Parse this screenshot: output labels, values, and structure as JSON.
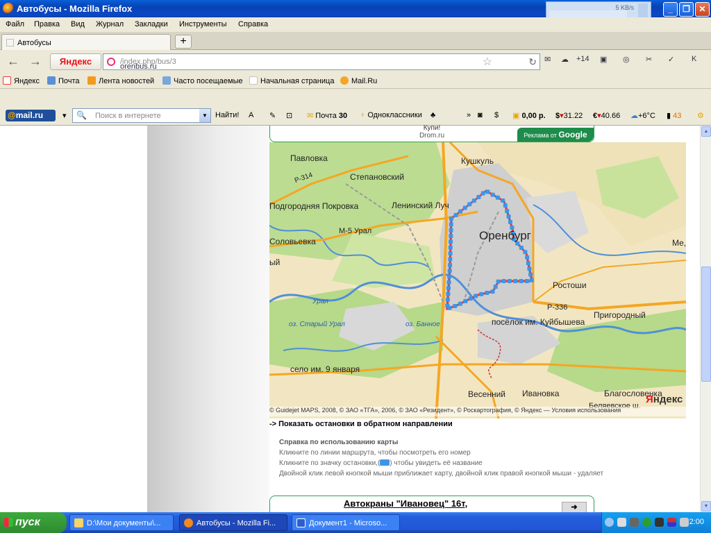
{
  "window": {
    "title": "Автобусы - Mozilla Firefox",
    "minimize": "_",
    "maximize": "❐",
    "close": "✕"
  },
  "netmeter": {
    "speed": "5 KB/s"
  },
  "menu": [
    "Файл",
    "Правка",
    "Вид",
    "Журнал",
    "Закладки",
    "Инструменты",
    "Справка"
  ],
  "tab": {
    "label": "Автобусы",
    "newtab": "+"
  },
  "nav": {
    "back": "←",
    "forward": "→",
    "yandex_button": "Яндекс",
    "url_host": "orenbus.ru",
    "url_path": "/index.php/bus/3",
    "weather_delta": "+14"
  },
  "bookmarks": [
    "Яндекс",
    "Почта",
    "Лента новостей",
    "Часто посещаемые",
    "Начальная страница",
    "Mail.Ru"
  ],
  "mailbar": {
    "logo_at": "@",
    "logo_text": "mail.ru",
    "search_placeholder": "Поиск в интернете",
    "find_button": "Найти!",
    "mail_label": "Почта",
    "mail_count": "30",
    "odnoklassniki": "Одноклассники",
    "balance": "0,00 р.",
    "usd": "31.22",
    "eur": "40.66",
    "temp": "+6°C",
    "count": "43"
  },
  "ad_top": {
    "line1": "Купи!",
    "line2": "Drom.ru",
    "badge_text": "Реклама от",
    "badge_brand": "Google"
  },
  "map": {
    "labels": [
      "Павловка",
      "Кушкуль",
      "Степановский",
      "Подгородняя Покровка",
      "Ленинский Луч",
      "М-5 Урал",
      "Соловьевка",
      "Оренбург",
      "Ме,",
      "Ростоши",
      "Урал",
      "оз. Старый Урал",
      "оз. Банное",
      "Р-336",
      "посёлок им. Куйбышева",
      "Пригородный",
      "село им. 9 января",
      "Весенний",
      "Ивановка",
      "Благословенка",
      "Беляевское ш.",
      "Р-314",
      "ый"
    ],
    "copyright": "© Guidejet MAPS, 2008, © ЗАО «ТГА», 2006, © ЗАО «Резидент», © Роскартография, © Яндекс — Условия использования",
    "logo_ya": "Я",
    "logo_rest": "ндекс"
  },
  "show_back": "-> Показать остановки в обратном направлении",
  "help": {
    "title": "Справка по использованию карты",
    "line1": "Кликните по линии маршрута, чтобы посмотреть его номер",
    "line2": "Кликните по значку остановки,(",
    "line2b": ") чтобы увидеть её название",
    "line3": "Двойной клик левой кнопкой мыши приближает карту, двойной клик правой кнопкой мыши - удаляет"
  },
  "ad_bottom": {
    "title": "Автокраны \"Ивановец\" 16т,",
    "go": "➜"
  },
  "taskbar": {
    "start": "пуск",
    "tasks": [
      "D:\\Мои документы\\...",
      "Автобусы - Mozilla Fi...",
      "Документ1 - Microso..."
    ],
    "clock": "2:00"
  },
  "colors": {
    "route": "#e5322d",
    "stop": "#3e95e8",
    "river": "#4f8fd8",
    "green": "#b6d98a",
    "city": "#cfcfcf",
    "road": "#f5a623"
  }
}
